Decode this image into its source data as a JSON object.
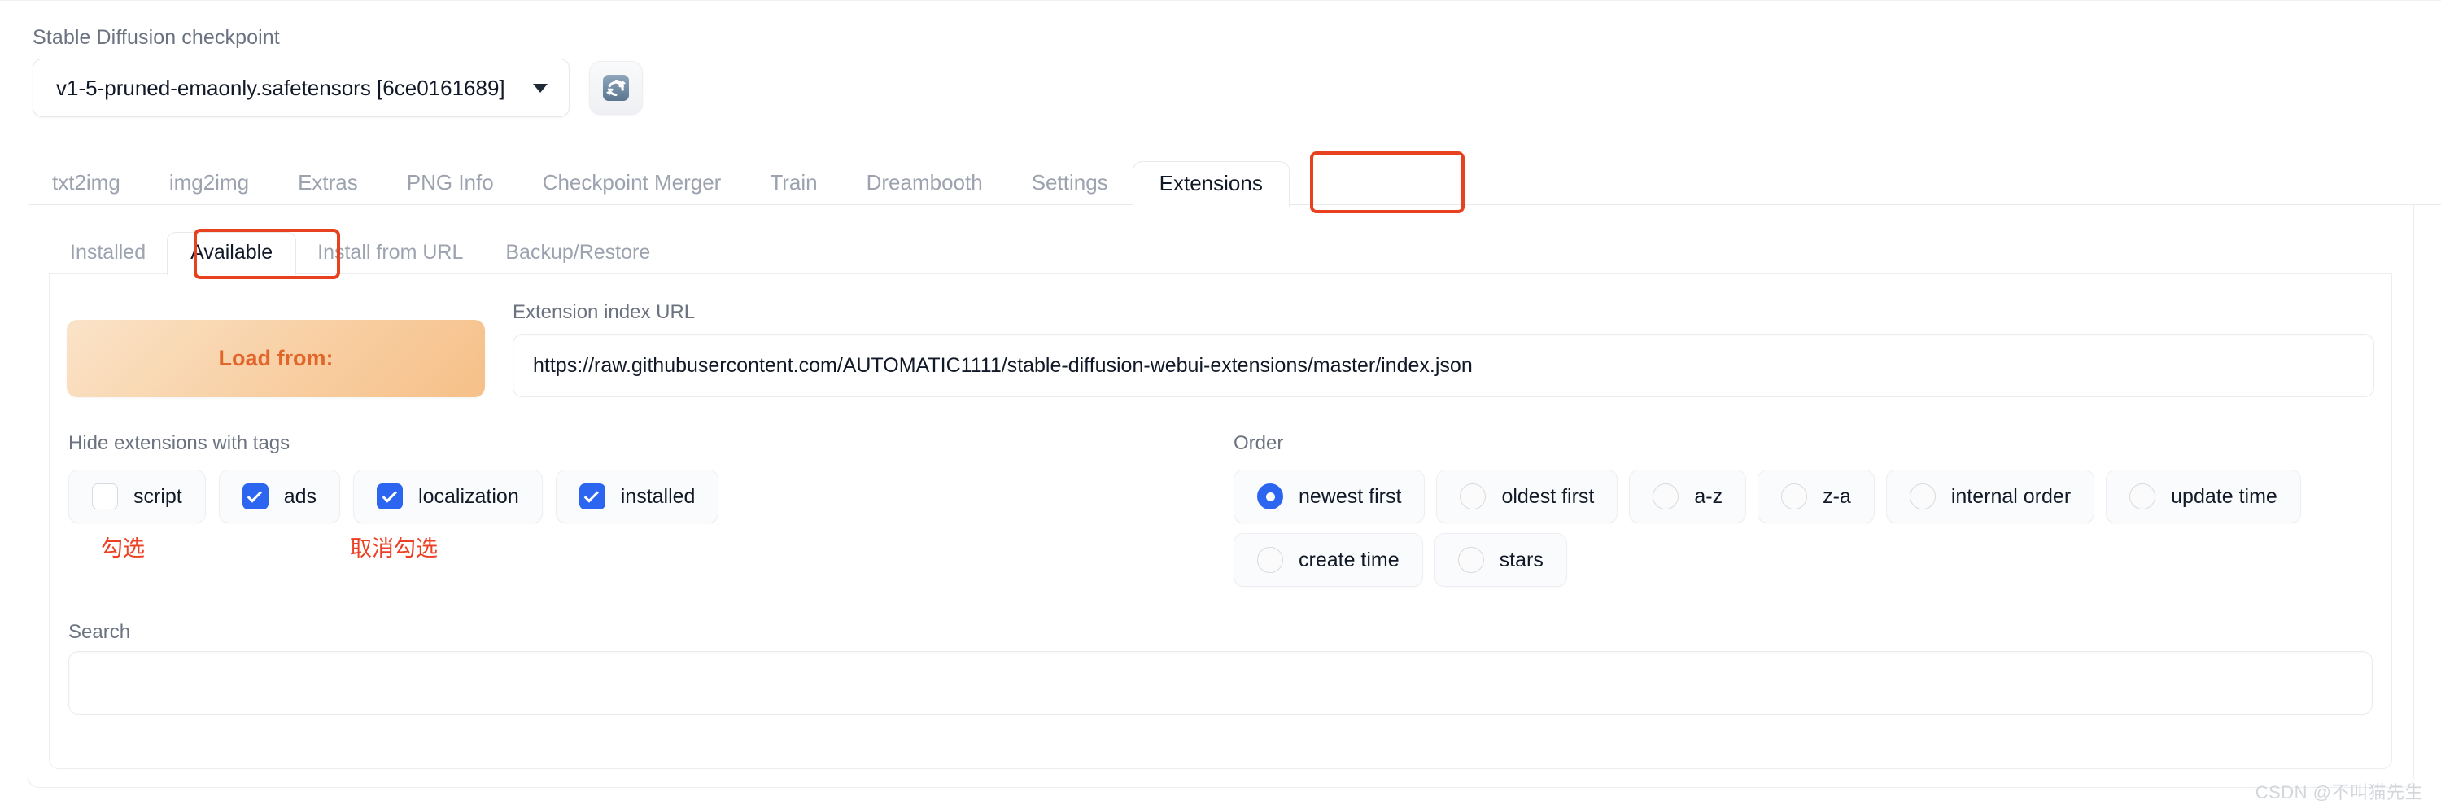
{
  "checkpoint": {
    "label": "Stable Diffusion checkpoint",
    "selected": "v1-5-pruned-emaonly.safetensors [6ce0161689]",
    "refresh_icon": "refresh-icon"
  },
  "main_tabs": [
    {
      "label": "txt2img",
      "active": false
    },
    {
      "label": "img2img",
      "active": false
    },
    {
      "label": "Extras",
      "active": false
    },
    {
      "label": "PNG Info",
      "active": false
    },
    {
      "label": "Checkpoint Merger",
      "active": false
    },
    {
      "label": "Train",
      "active": false
    },
    {
      "label": "Dreambooth",
      "active": false
    },
    {
      "label": "Settings",
      "active": false
    },
    {
      "label": "Extensions",
      "active": true
    }
  ],
  "sub_tabs": [
    {
      "label": "Installed",
      "active": false
    },
    {
      "label": "Available",
      "active": true
    },
    {
      "label": "Install from URL",
      "active": false
    },
    {
      "label": "Backup/Restore",
      "active": false
    }
  ],
  "load": {
    "button_label": "Load from:",
    "url_label": "Extension index URL",
    "url_value": "https://raw.githubusercontent.com/AUTOMATIC1111/stable-diffusion-webui-extensions/master/index.json"
  },
  "tags": {
    "label": "Hide extensions with tags",
    "items": [
      {
        "label": "script",
        "checked": false
      },
      {
        "label": "ads",
        "checked": true
      },
      {
        "label": "localization",
        "checked": true
      },
      {
        "label": "installed",
        "checked": true
      }
    ]
  },
  "annotations": [
    {
      "text": "勾选"
    },
    {
      "text": "取消勾选"
    }
  ],
  "order": {
    "label": "Order",
    "row1": [
      {
        "label": "newest first",
        "checked": true
      },
      {
        "label": "oldest first",
        "checked": false
      },
      {
        "label": "a-z",
        "checked": false
      },
      {
        "label": "z-a",
        "checked": false
      },
      {
        "label": "internal order",
        "checked": false
      },
      {
        "label": "update time",
        "checked": false
      }
    ],
    "row2": [
      {
        "label": "create time",
        "checked": false
      },
      {
        "label": "stars",
        "checked": false
      }
    ]
  },
  "search": {
    "label": "Search",
    "value": "",
    "placeholder": ""
  },
  "watermark": "CSDN @不叫猫先生",
  "colors": {
    "accent_blue": "#2b65f0",
    "highlight_red": "#e8411f",
    "load_orange": "#e2662c"
  }
}
